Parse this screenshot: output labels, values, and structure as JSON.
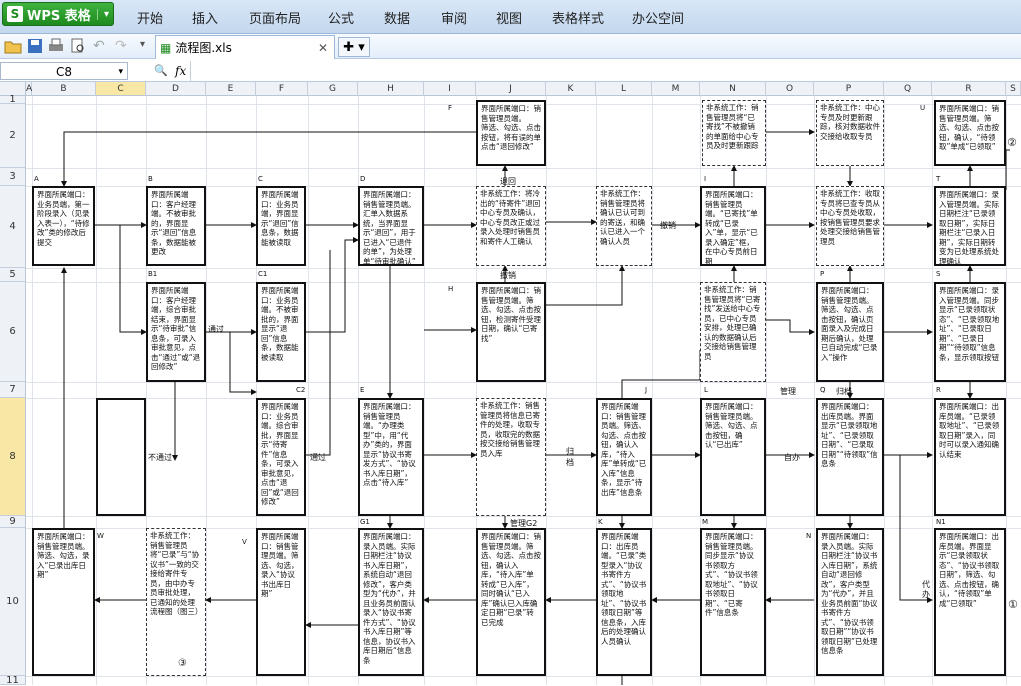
{
  "app": {
    "name": "WPS 表格",
    "logo": "S"
  },
  "menu": [
    "开始",
    "插入",
    "页面布局",
    "公式",
    "数据",
    "审阅",
    "视图",
    "表格样式",
    "办公空间"
  ],
  "tab": {
    "filename": "流程图.xls"
  },
  "formula": {
    "cell": "C8",
    "fx": "fx"
  },
  "columns": [
    "A",
    "B",
    "C",
    "D",
    "E",
    "F",
    "G",
    "H",
    "I",
    "J",
    "K",
    "L",
    "M",
    "N",
    "O",
    "P",
    "Q",
    "R",
    "S"
  ],
  "rows": [
    "1",
    "2",
    "3",
    "4",
    "5",
    "6",
    "7",
    "8",
    "9",
    "10",
    "11"
  ],
  "boxes": {
    "J2": "界面所属端口：销售管理员端。\n筛选、勾选、点击按钮，将有误的单点击“退回修改”",
    "N2": "非系统工作：销售管理员将“已寄找”不被撤销的单面给中心专员及时更新跟踪",
    "P2": "非系统工作：中心专员及时更新跟踪，核对数据收件交接给收取专员",
    "R2": "界面所属端口：销售管理员端。筛选、勾选、点击按钮，确认，“待领取”单成“已领取”",
    "A4": "界面所属端口：业务员端，第一阶段录入（见录入表一），“待修改”类的修改后提交",
    "B4": "界面所属端口：客户经理端。不被审批的，界面显示“退回”信息条，数据能被更改",
    "C4": "界面所属端口：业务员端，界面显示“退回”信息条，数据能被读取",
    "D4": "界面所属端口：销售管理员端。汇单入数据系统，当界面显示“退回”，用于已进入“已退件的单”，为处理单“待审批确认”",
    "J4": "非系统工作：将冷出的“待寄件”退回中心专员及确认，中心专员改正或过录入处理时销售员和寄件人工确认",
    "L4": "非系统工作：销售管理员将确认已认可到的寄送，和确认已进入一个确认人员",
    "N4": "界面所属端口：销售管理员端。“已寄找”单转成“已录入”单，显示“已录入确定”框，在中心专员前日期",
    "P4": "非系统工作：收取专员将已查专员从中心专员处收取，按销售管理员要求处理交接给销售管理员",
    "R4": "界面所属端口：录入管理员端。实际日期栏注“已录领取日期”，实际日期栏注“已录入日期”，实际日期转变为已处理系统处理确认",
    "B6": "界面所属端口：客户经理端，综合审批结束，界面显示“待审批”信息条，可录入审批意见，点击“通过”或“退回修改”",
    "C6": "界面所属端口：业务员端。不被审批的，界面显示“退回”信息条，数据能被读取",
    "J6": "界面所属端口：销售管理员端。筛选、勾选、点击按钮，检测寄件受理日期，确认“已寄找”",
    "N6": "非系统工作：销售管理员将“已寄找”发送给中心专员，已中心专员安排，处理已确认的数据确认后交接给销售管理员",
    "P6": "界面所属端口：销售管理员端。筛选、勾选、点击按钮，确认页面录入及完成日期后确认，处理已自动完成“已录入”操作",
    "R6": "界面所属端口：录入管理员端。同步显示“已录领取状态”、“已录领取地址”、“已录取日期”、“已录日期”“待领取”信息条，显示领取按钮",
    "C8": "界面所属端口：业务员端。综合审批，界面显示“待寄件”信息条，可录入审批意见，点击“退回”或“退回修改”",
    "E8": "界面所属端口：销售管理员端。“办理类型”中，用“代办”类的，界面显示“协议书寄发方式”、“协议书入库日期”，点击“待入库”",
    "H8": "非系统工作：销售管理员将信息已寄件的处理，收取专员，收取完的数据按交接给销售管理员入库",
    "J8": "界面所属端口：销售管理员端。筛选、勾选、点击按钮，确认入库，“待入库”单转成“已入库”信息条，显示“待出库”信息条",
    "L8": "界面所属端口：销售管理员端。筛选、勾选、点击按钮，确认“已出库”",
    "P8": "界面所属端口：出库员端。界面显示“已录领取地址”、“已录领取日期”、“已录取日期”“待领取”信息条",
    "R8": "界面所属端口：出库员端。“已录领取地址”、“已录领取日期”录入，同时可以录入通知确认结束",
    "A10": "界面所属端口：销售管理员端。筛选、勾选，录入“已录出库日期”",
    "C10": "非系统工作：销售管理员将“已录”与“协议书”一致的交接给寄件专员，由中办专员审批处理，已通知的处理流程图（图三）",
    "F10": "界面所属端口：销售管理员端。筛选、勾选，录入“协议书出库日期”",
    "H10": "界面所属端口：录入员端。实际日期栏注“协议书入库日期”，系统自动“退回修改”，客户类型为“代办”，并且业务员前面认录入“协议书寄件方式”、“协议书入库日期”等信息，协议书入库日期后“信息条",
    "J10": "界面所属端口：销售管理员端。筛选、勾选、点击按钮，确认入库，“待入库”单转成“已入库”，同时确认“已入库”确认已入库确定日期“已录”转已完成",
    "L10": "界面所属端口：出库员端。“已录”类型录入“协议书寄件方式”、“协议书领取地址”、“协议书领取日期”等信息条，入库后的处理确认人员确认",
    "N10": "界面所属端口：销售管理员端。同步显示“协议书领取方式”、“协议书领取地址”、“协议书领取日期”、“已寄件”信息条",
    "P10": "界面所属端口：录入员端。实际日期栏注“协议书入库日期”，系统自动“退回修改”，客户类型为“代办”，并且业务员前面“协议书寄件方式”、“协议书领取日期”“协议书领取日期”已处理信息条",
    "R10": "界面所属端口：出库员端。界面显示“已录领取状态”、“协议书领取日期”，筛选、勾选、点击按钮，确认，“待领取”单成“已领取”"
  },
  "labels": {
    "A": "A",
    "B": "B",
    "C": "C",
    "D": "D",
    "F": "F",
    "U": "U",
    "I": "I",
    "T": "T",
    "B1": "B1",
    "C1": "C1",
    "H": "H",
    "P": "P",
    "S": "S",
    "C2": "C2",
    "E": "E",
    "J": "J",
    "L": "L",
    "Q": "Q",
    "R": "R",
    "W": "W",
    "V": "V",
    "G1": "G1",
    "K": "K",
    "M": "M",
    "N": "N",
    "N1": "N1",
    "back": "退回",
    "withdraw": "撤销",
    "cancel": "撤销",
    "pass": "通过",
    "notpass": "不通过",
    "pass2": "通过",
    "gui": "归档",
    "gui2": "归档",
    "self": "自办",
    "agent": "代办",
    "confirmG2": "管理G2",
    "mgr": "管理",
    "circ1": "①",
    "circ2": "②",
    "circ3": "③"
  }
}
